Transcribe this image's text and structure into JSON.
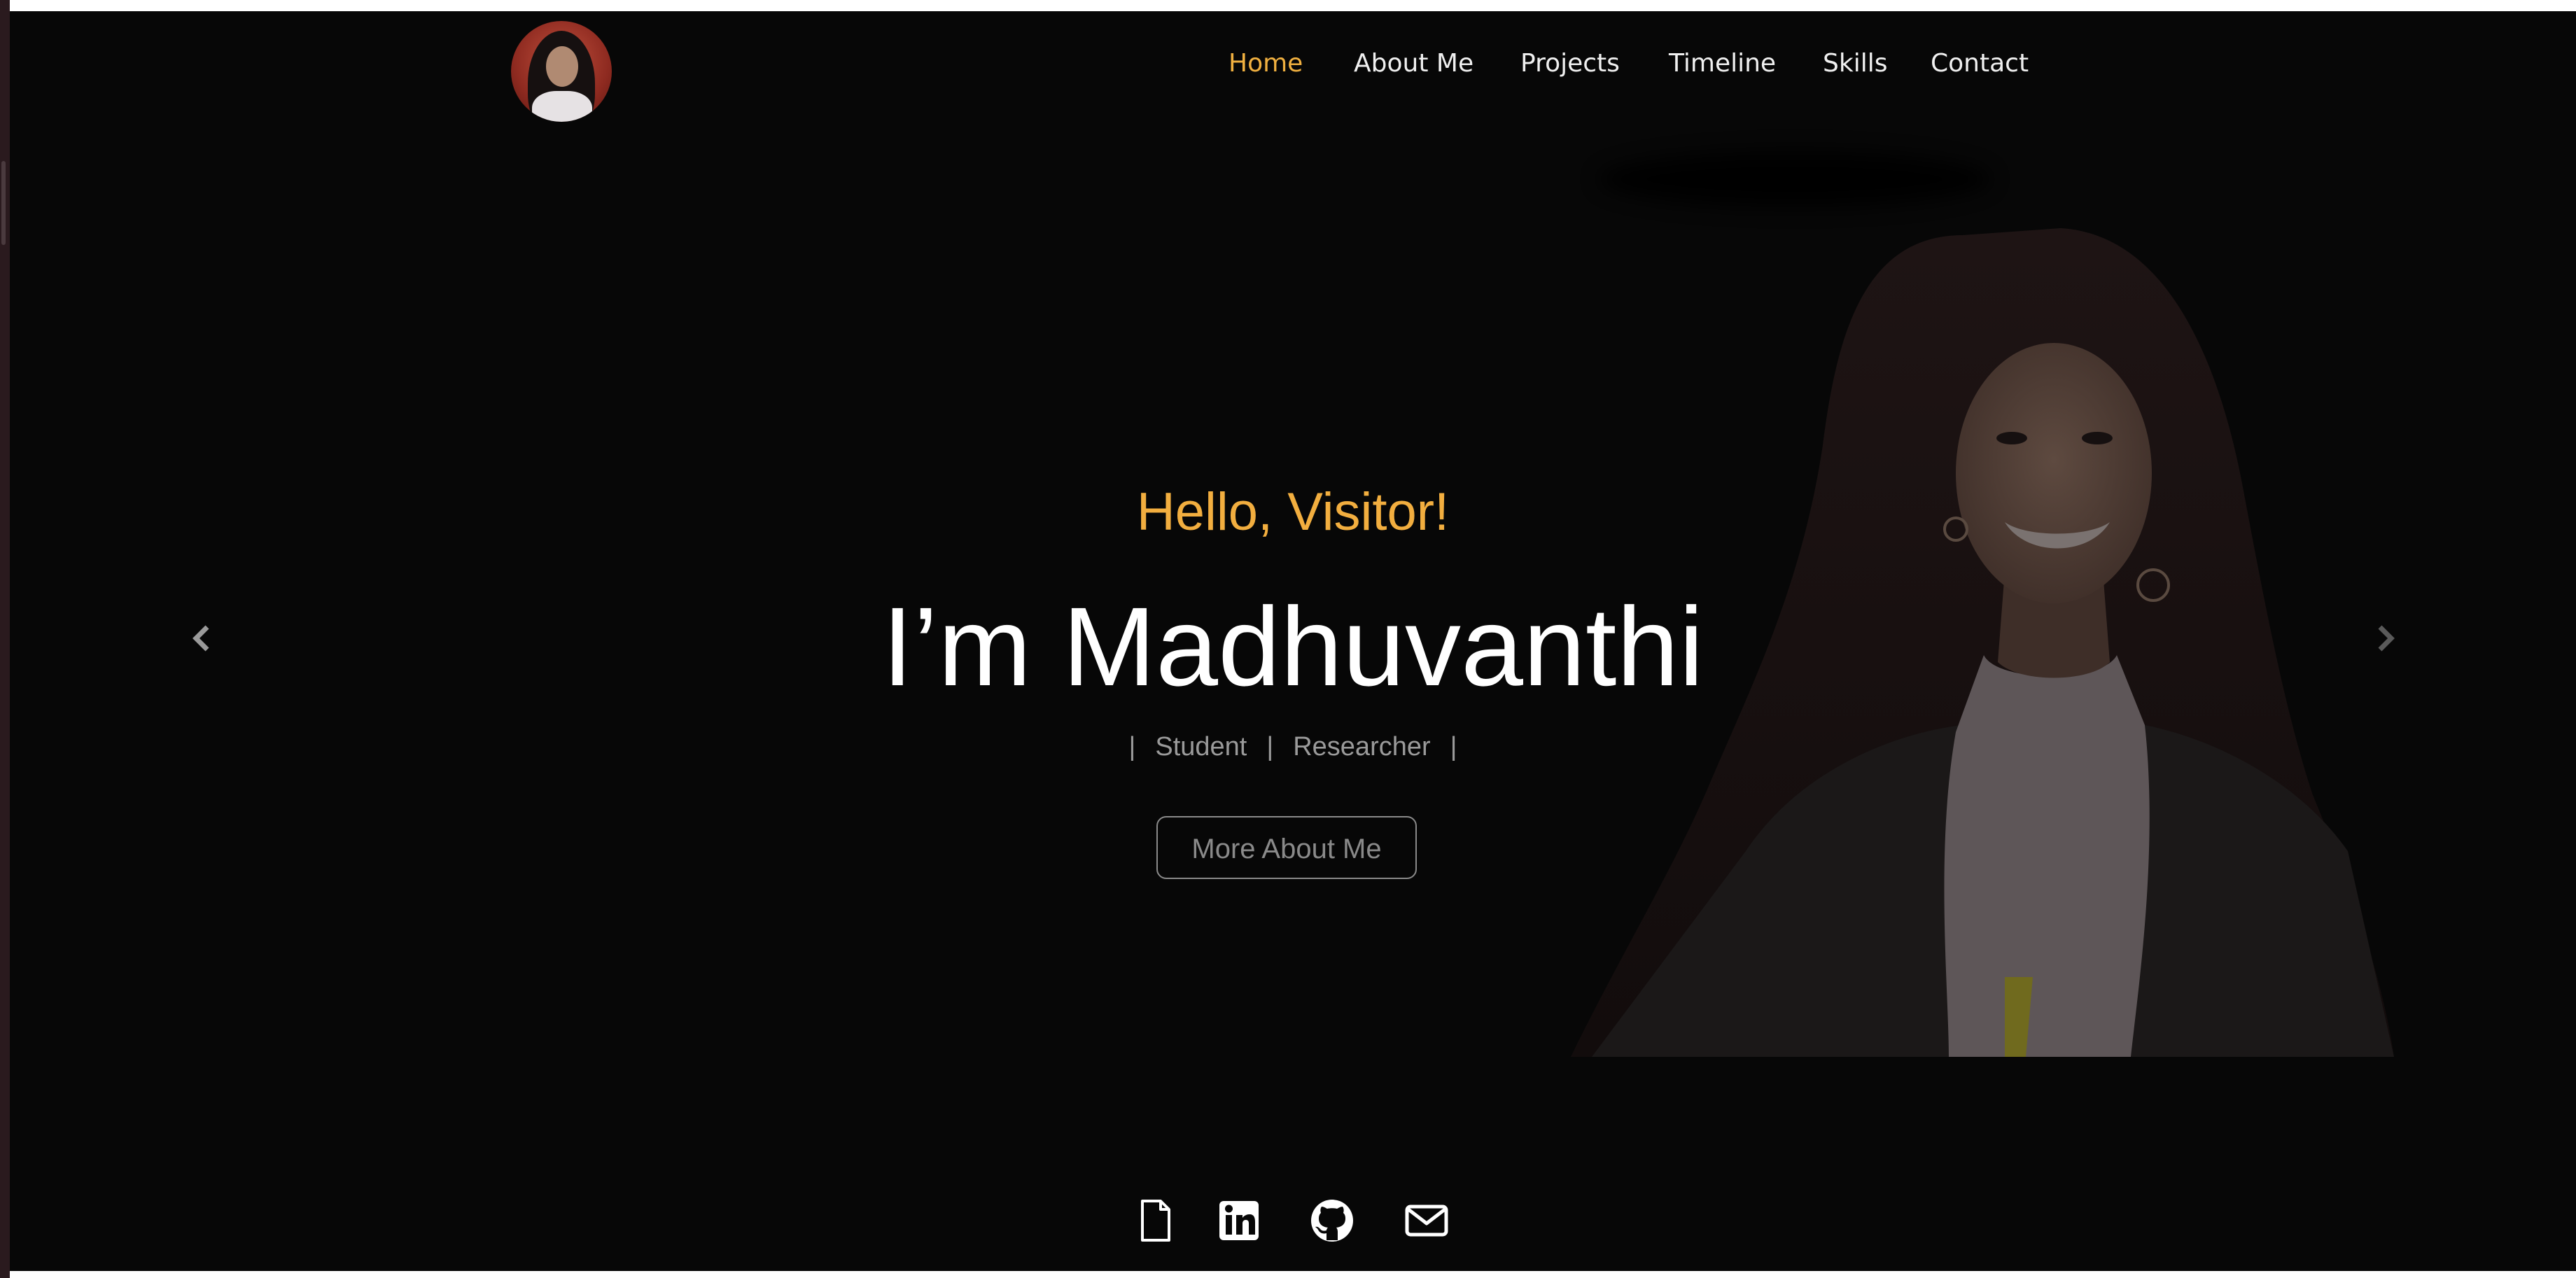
{
  "nav": {
    "items": [
      {
        "label": "Home",
        "active": true
      },
      {
        "label": "About Me",
        "active": false
      },
      {
        "label": "Projects",
        "active": false
      },
      {
        "label": "Timeline",
        "active": false
      },
      {
        "label": "Skills",
        "active": false
      },
      {
        "label": "Contact",
        "active": false
      }
    ]
  },
  "hero": {
    "greeting": "Hello, Visitor!",
    "headline": "I’m Madhuvanthi",
    "roles": [
      "Student",
      "Researcher"
    ],
    "role_separator": "|",
    "cta_label": "More About Me"
  },
  "carousel": {
    "prev_icon": "chevron-left-icon",
    "next_icon": "chevron-right-icon"
  },
  "socials": [
    {
      "icon": "document-icon"
    },
    {
      "icon": "linkedin-icon"
    },
    {
      "icon": "github-icon"
    },
    {
      "icon": "mail-icon"
    }
  ],
  "colors": {
    "background": "#070707",
    "accent": "#f2ae3f",
    "nav_text": "#f0f0f0",
    "muted": "#9a9a9a"
  }
}
